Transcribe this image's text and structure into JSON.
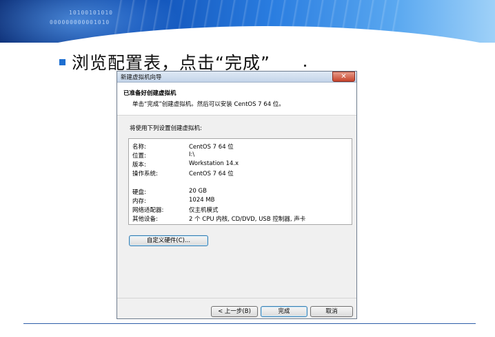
{
  "slide": {
    "binary_1": "10100101010",
    "binary_2": "000000000001010",
    "instruction": "浏览配置表，点击“完成”"
  },
  "dialog": {
    "title": "新建虚拟机向导",
    "close_label": "✕",
    "header_title": "已准备好创建虚拟机",
    "header_subtitle": "单击“完成”创建虚拟机。然后可以安装 CentOS 7 64 位。",
    "intro": "将使用下列设置创建虚拟机:",
    "settings": [
      {
        "key": "名称:",
        "value": "CentOS 7 64 位"
      },
      {
        "key": "位置:",
        "value": "I:\\"
      },
      {
        "key": "版本:",
        "value": "Workstation 14.x"
      },
      {
        "key": "操作系统:",
        "value": "CentOS 7 64 位"
      },
      {
        "key": "硬盘:",
        "value": "20 GB"
      },
      {
        "key": "内存:",
        "value": "1024 MB"
      },
      {
        "key": "网络适配器:",
        "value": "仅主机模式"
      },
      {
        "key": "其他设备:",
        "value": "2 个 CPU 内核, CD/DVD, USB 控制器, 声卡"
      }
    ],
    "customize_label": "自定义硬件(C)...",
    "back_label": "< 上一步(B)",
    "finish_label": "完成",
    "cancel_label": "取消"
  }
}
